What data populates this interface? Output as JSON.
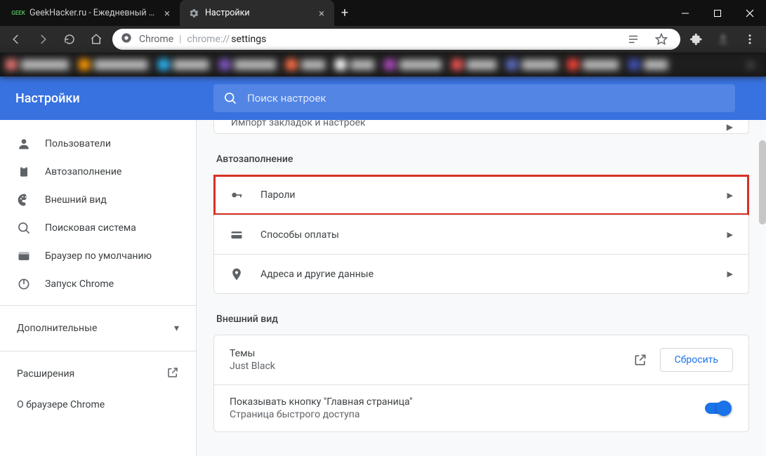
{
  "window": {
    "tabs": [
      {
        "title": "GeekHacker.ru - Ежедневный жу",
        "favicon_text": "GEEK",
        "favicon_color": "#4caf50"
      },
      {
        "title": "Настройки"
      }
    ],
    "toolbar": {
      "address_label": "Chrome",
      "address_url": "chrome://settings",
      "address_url_dim": "chrome://",
      "address_url_path": "settings"
    }
  },
  "settings": {
    "title": "Настройки",
    "search_placeholder": "Поиск настроек",
    "sidebar": {
      "items": [
        {
          "label": "Пользователи",
          "icon": "person"
        },
        {
          "label": "Автозаполнение",
          "icon": "clipboard"
        },
        {
          "label": "Внешний вид",
          "icon": "palette"
        },
        {
          "label": "Поисковая система",
          "icon": "search"
        },
        {
          "label": "Браузер по умолчанию",
          "icon": "browser"
        },
        {
          "label": "Запуск Chrome",
          "icon": "power"
        }
      ],
      "advanced": "Дополнительные",
      "extensions": "Расширения",
      "about": "О браузере Chrome"
    },
    "content": {
      "truncated_top": "Импорт закладок и настроек",
      "autofill": {
        "title": "Автозаполнение",
        "rows": [
          {
            "label": "Пароли",
            "icon": "key",
            "highlight": true
          },
          {
            "label": "Способы оплаты",
            "icon": "card"
          },
          {
            "label": "Адреса и другие данные",
            "icon": "location"
          }
        ]
      },
      "appearance": {
        "title": "Внешний вид",
        "theme_label": "Темы",
        "theme_name": "Just Black",
        "reset_button": "Сбросить",
        "home_button_label": "Показывать кнопку \"Главная страница\"",
        "home_button_sub": "Страница быстрого доступа",
        "home_button_on": true
      }
    }
  }
}
